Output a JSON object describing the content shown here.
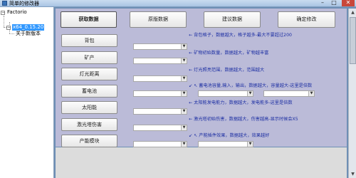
{
  "window": {
    "title": "简单的修改器",
    "minimize": "–",
    "maximize": "□",
    "close": "✕"
  },
  "tree": {
    "root": "Factorio",
    "version": "x64_0.15.20",
    "about": "关于新版本"
  },
  "top_buttons": {
    "read": "获取数据",
    "original": "原版数据",
    "suggest": "建议数据",
    "confirm": "确定修改"
  },
  "side_buttons": [
    "背包",
    "矿产",
    "灯光距离",
    "蓄电池",
    "太阳能",
    "激光塔伤害",
    "产能模块"
  ],
  "notes": [
    "←  背包格子，数据越大，格子越多-最大不要超过200",
    "←  矿物初始数量，数据越大，矿物越丰富",
    "←  灯光照亮范围，数据越大，范围越大",
    "↙  ↖ 蓄电池容量,输入，输出，数据越大，容量越大-这里是倍数",
    "←  太阳能发电能力，数据越大，发电能多-这里是倍数",
    "←  激光塔初始伤害，数据越大，伤害越高-显示时候会X5",
    "↙  ↖ 产能插件效果，数据越大，效果越好"
  ],
  "colors": {
    "panel": "#bbbbd8",
    "note_text": "#1d2fa3",
    "selected": "#3399ff"
  }
}
